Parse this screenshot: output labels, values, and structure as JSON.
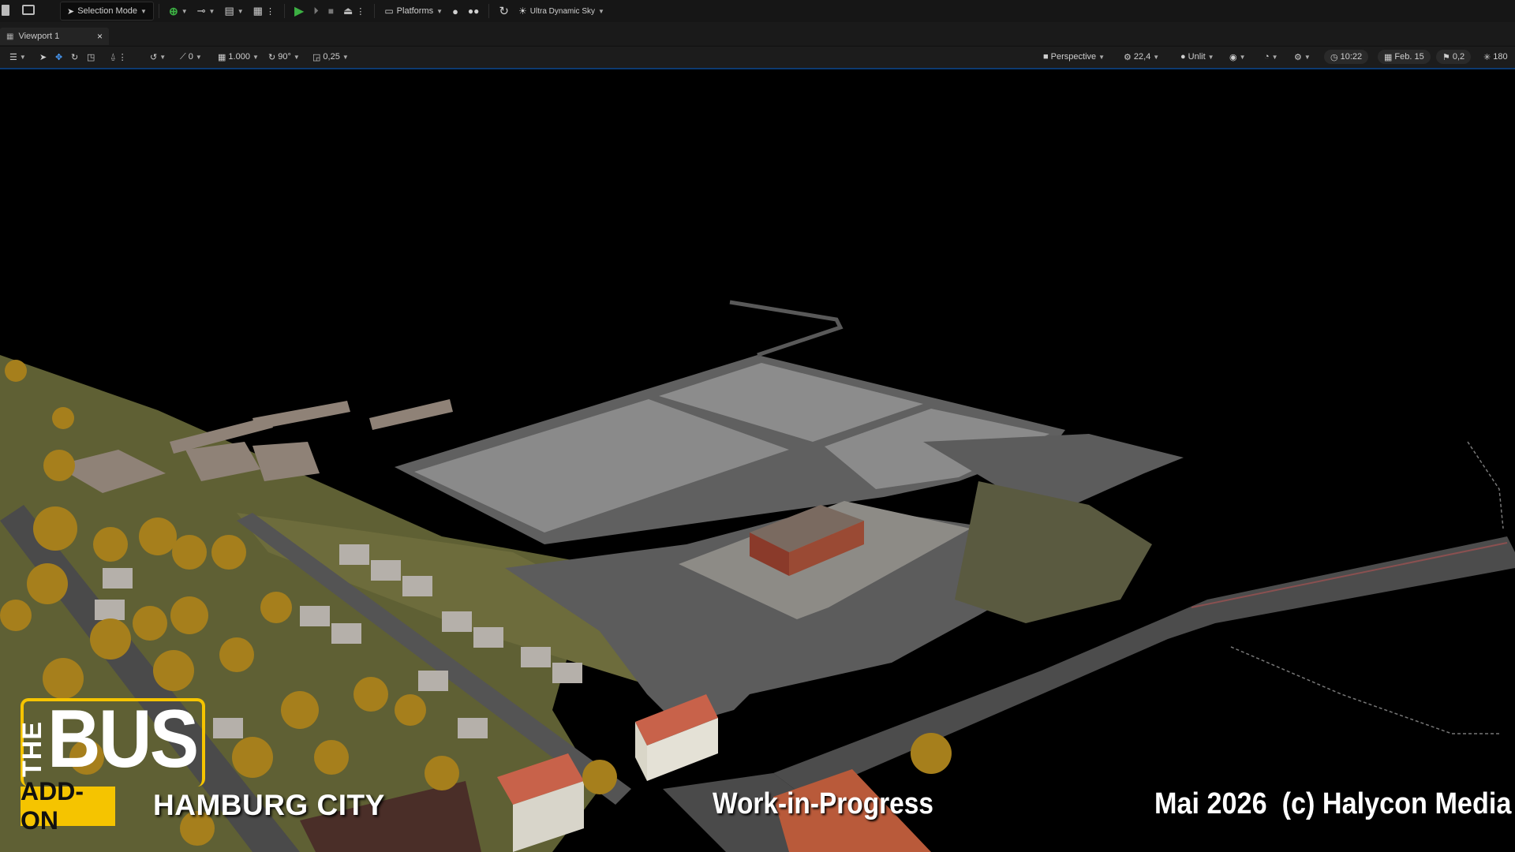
{
  "toolbar": {
    "mode_label": "Selection Mode",
    "platforms_label": "Platforms",
    "sky_label": "Ultra Dynamic Sky"
  },
  "tab": {
    "label": "Viewport 1",
    "close": "×"
  },
  "viewport_toolbar": {
    "rotation_snap": "0",
    "scale_value": "1.000",
    "angle_value": "90°",
    "grid_value": "0,25",
    "view_mode": "Perspective",
    "camera_speed": "22,4",
    "lit_mode": "Unlit",
    "time": "10:22",
    "date": "Feb. 15",
    "flag_value": "0,2",
    "sun_value": "180"
  },
  "overlay": {
    "logo_the": "THE",
    "logo_bus": "BUS",
    "logo_addon": "ADD-ON",
    "city": "HAMBURG CITY",
    "wip": "Work-in-Progress",
    "copyright": "Mai 2026  (c) Halycon Media"
  },
  "colors": {
    "accent_line": "#0d3a70",
    "play_green": "#3cb043",
    "logo_yellow": "#f5c400",
    "ground_grass": "#6b6a3e",
    "asphalt": "#5e5e5e",
    "trees": "#a67f1c"
  }
}
